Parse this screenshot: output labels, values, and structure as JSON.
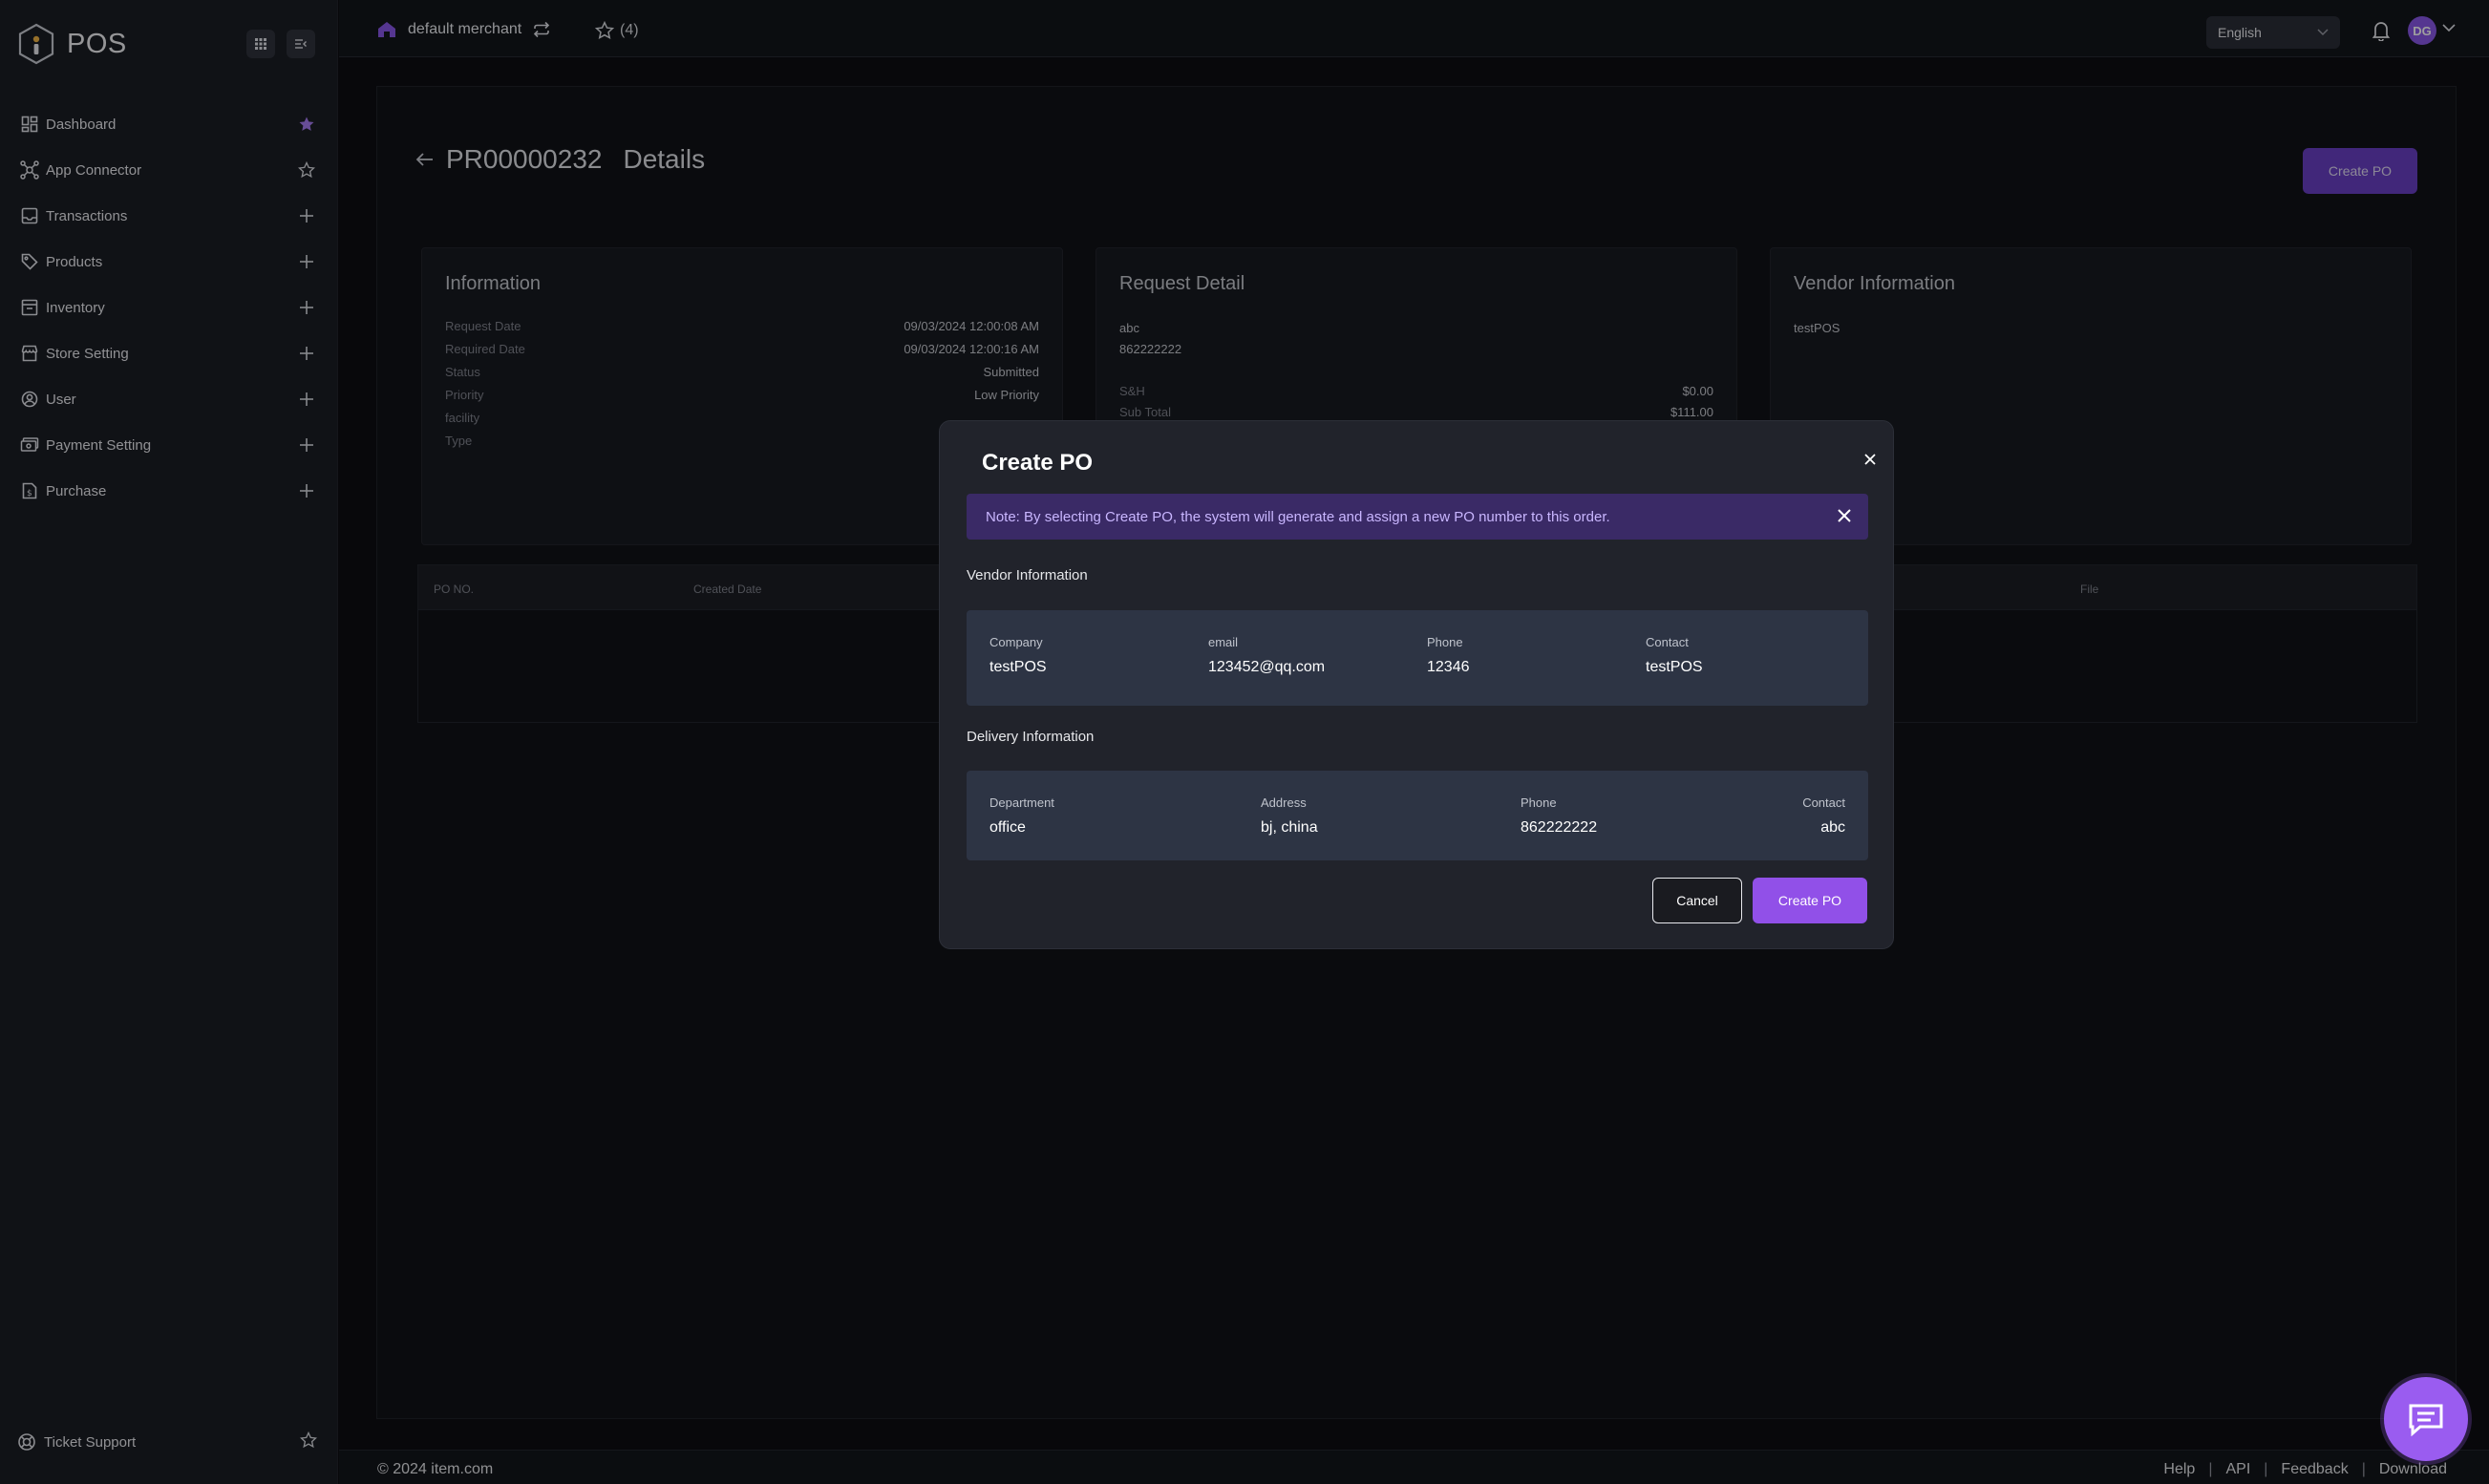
{
  "brand": {
    "name": "POS"
  },
  "sidebar": {
    "items": [
      {
        "label": "Dashboard",
        "icon": "dashboard-icon",
        "trail": "star-filled"
      },
      {
        "label": "App Connector",
        "icon": "app-connector-icon",
        "trail": "star-outline"
      },
      {
        "label": "Transactions",
        "icon": "transactions-icon",
        "trail": "plus"
      },
      {
        "label": "Products",
        "icon": "products-tag-icon",
        "trail": "plus"
      },
      {
        "label": "Inventory",
        "icon": "inventory-icon",
        "trail": "plus"
      },
      {
        "label": "Store Setting",
        "icon": "store-icon",
        "trail": "plus"
      },
      {
        "label": "User",
        "icon": "user-icon",
        "trail": "plus"
      },
      {
        "label": "Payment Setting",
        "icon": "payment-icon",
        "trail": "plus"
      },
      {
        "label": "Purchase",
        "icon": "purchase-icon",
        "trail": "plus"
      }
    ],
    "ticket_support": "Ticket Support"
  },
  "topbar": {
    "merchant": "default merchant",
    "favorites_count": "(4)",
    "language": "English",
    "avatar_initials": "DG"
  },
  "page": {
    "id": "PR00000232",
    "title_suffix": "Details",
    "create_po_label": "Create PO"
  },
  "information": {
    "title": "Information",
    "rows": [
      {
        "k": "Request Date",
        "v": "09/03/2024 12:00:08 AM"
      },
      {
        "k": "Required Date",
        "v": "09/03/2024 12:00:16 AM"
      },
      {
        "k": "Status",
        "v": "Submitted"
      },
      {
        "k": "Priority",
        "v": "Low Priority"
      },
      {
        "k": "facility",
        "v": ""
      },
      {
        "k": "Type",
        "v": ""
      }
    ]
  },
  "request_detail": {
    "title": "Request Detail",
    "line1": "abc",
    "line2": "862222222",
    "rows": [
      {
        "k": "S&H",
        "v": "$0.00"
      },
      {
        "k": "Sub Total",
        "v": "$111.00"
      }
    ]
  },
  "vendor_info_panel": {
    "title": "Vendor Information",
    "name": "testPOS"
  },
  "table": {
    "columns": [
      "PO NO.",
      "Created Date",
      "File"
    ]
  },
  "modal": {
    "title": "Create PO",
    "note": "Note: By selecting Create PO, the system will generate and assign a new PO number to this order.",
    "vendor_section": "Vendor Information",
    "vendor": {
      "company_label": "Company",
      "company": "testPOS",
      "email_label": "email",
      "email": "123452@qq.com",
      "phone_label": "Phone",
      "phone": "12346",
      "contact_label": "Contact",
      "contact": "testPOS"
    },
    "delivery_section": "Delivery Information",
    "delivery": {
      "department_label": "Department",
      "department": "office",
      "address_label": "Address",
      "address": "bj, china",
      "phone_label": "Phone",
      "phone": "862222222",
      "contact_label": "Contact",
      "contact": "abc"
    },
    "cancel_label": "Cancel",
    "create_label": "Create PO"
  },
  "footer": {
    "copyright": "© 2024 item.com",
    "links": [
      "Help",
      "API",
      "Feedback",
      "Download"
    ],
    "separator": "|"
  },
  "colors": {
    "accent": "#9150e8",
    "sidebar_bg": "#1b1d24",
    "modal_bg": "#21232b",
    "note_bg": "#3a2a66",
    "info_box_bg": "#2d3444"
  }
}
